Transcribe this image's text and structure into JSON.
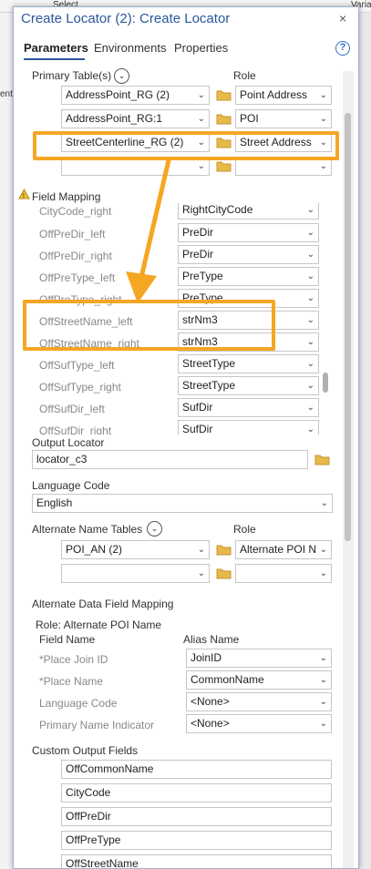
{
  "background": {
    "toolbar_text": "Select",
    "right_text": "Variabl",
    "left_text": "ent"
  },
  "dialog": {
    "title": "Create Locator (2): Create Locator",
    "close": "×"
  },
  "tabs": [
    {
      "label": "Parameters"
    },
    {
      "label": "Environments"
    },
    {
      "label": "Properties"
    }
  ],
  "help": "?",
  "primary_tables": {
    "label": "Primary Table(s)",
    "role_label": "Role",
    "rows": [
      {
        "table": "AddressPoint_RG (2)",
        "role": "Point Address"
      },
      {
        "table": "AddressPoint_RG:1",
        "role": "POI"
      },
      {
        "table": "StreetCenterline_RG (2)",
        "role": "Street Address"
      },
      {
        "table": "",
        "role": ""
      }
    ]
  },
  "field_mapping": {
    "label": "Field Mapping",
    "rows": [
      {
        "field": "CityCode_right",
        "value": "RightCityCode"
      },
      {
        "field": "OffPreDir_left",
        "value": "PreDir"
      },
      {
        "field": "OffPreDir_right",
        "value": "PreDir"
      },
      {
        "field": "OffPreType_left",
        "value": "PreType"
      },
      {
        "field": "OffPreType_right",
        "value": "PreType"
      },
      {
        "field": "OffStreetName_left",
        "value": "strNm3"
      },
      {
        "field": "OffStreetName_right",
        "value": "strNm3"
      },
      {
        "field": "OffSufType_left",
        "value": "StreetType"
      },
      {
        "field": "OffSufType_right",
        "value": "StreetType"
      },
      {
        "field": "OffSufDir_left",
        "value": "SufDir"
      },
      {
        "field": "OffSufDir_right",
        "value": "SufDir"
      }
    ]
  },
  "output_locator": {
    "label": "Output Locator",
    "value": "locator_c3"
  },
  "language": {
    "label": "Language Code",
    "value": "English"
  },
  "alt_name_tables": {
    "label": "Alternate Name Tables",
    "role_label": "Role",
    "rows": [
      {
        "table": "POI_AN (2)",
        "role": "Alternate POI N"
      },
      {
        "table": "",
        "role": ""
      }
    ]
  },
  "alt_data_mapping": {
    "label": "Alternate Data Field Mapping",
    "role_line": "Role: Alternate POI Name",
    "field_header": "Field Name",
    "alias_header": "Alias Name",
    "rows": [
      {
        "field": "*Place Join ID",
        "value": "JoinID"
      },
      {
        "field": "*Place Name",
        "value": "CommonName"
      },
      {
        "field": "Language Code",
        "value": "<None>"
      },
      {
        "field": "Primary Name Indicator",
        "value": "<None>"
      }
    ]
  },
  "custom_output": {
    "label": "Custom Output Fields",
    "fields": [
      "OffCommonName",
      "CityCode",
      "OffPreDir",
      "OffPreType",
      "OffStreetName"
    ]
  },
  "colors": {
    "accent": "#2b579a",
    "highlight": "#f5a623"
  },
  "icons": {
    "folder": "folder-icon",
    "dropdown": "chevron-down-icon",
    "warning": "warning-icon",
    "expand": "expand-circle-icon"
  }
}
